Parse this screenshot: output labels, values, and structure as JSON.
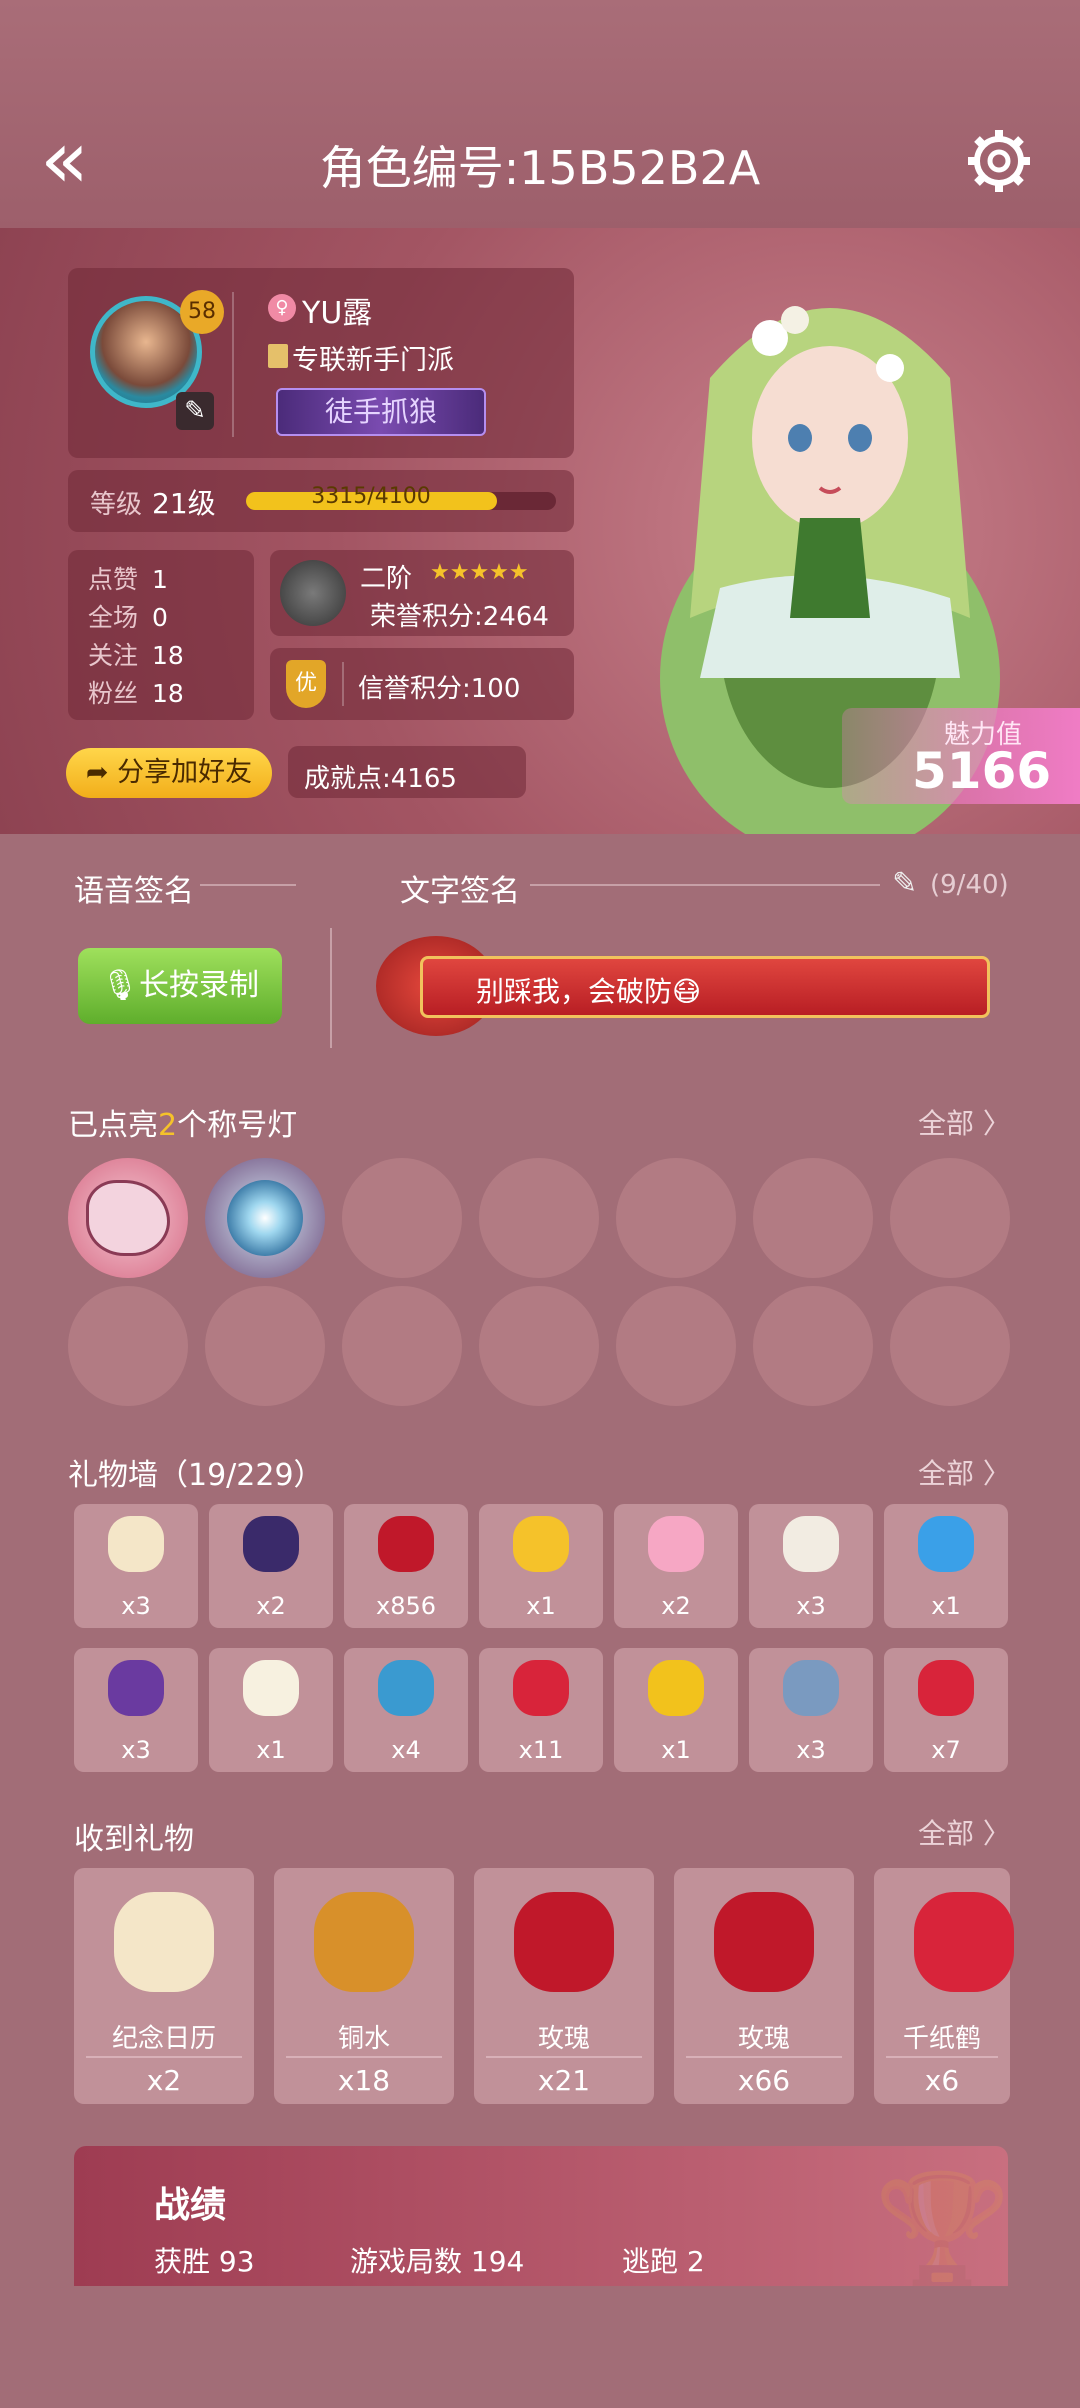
{
  "header": {
    "title": "角色编号:15B52B2A"
  },
  "profile": {
    "name": "YU露",
    "level_badge": "58",
    "sect": "专联新手门派",
    "title_tag": "徒手抓狼",
    "level_label": "等级",
    "level_value": "21级",
    "exp_text": "3315/4100",
    "exp_fraction": 0.8085,
    "stats": [
      {
        "label": "点赞",
        "value": "1"
      },
      {
        "label": "全场",
        "value": "0"
      },
      {
        "label": "关注",
        "value": "18"
      },
      {
        "label": "粉丝",
        "value": "18"
      }
    ],
    "rank_name": "二阶",
    "stars": "★★★★★",
    "honor_points": "荣誉积分:2464",
    "credit_badge": "优",
    "credit_points": "信誉积分:100",
    "share_button": "分享加好友",
    "achievement": "成就点:4165",
    "charm_label": "魅力值",
    "charm_value": "5166"
  },
  "signature": {
    "voice_label": "语音签名",
    "text_label": "文字签名",
    "count": "(9/40)",
    "record_button": "长按录制",
    "text": "别踩我，会破防😷"
  },
  "titles": {
    "prefix": "已点亮",
    "count": "2",
    "suffix": "个称号灯",
    "all": "全部 〉"
  },
  "gift_wall": {
    "title": "礼物墙（19/229）",
    "all": "全部 〉",
    "items": [
      {
        "icon": "calendar",
        "count": "x3"
      },
      {
        "icon": "eye",
        "count": "x2"
      },
      {
        "icon": "rose",
        "count": "x856"
      },
      {
        "icon": "stars",
        "count": "x1"
      },
      {
        "icon": "cotton-candy",
        "count": "x2"
      },
      {
        "icon": "ticket",
        "count": "x3"
      },
      {
        "icon": "magic-book",
        "count": "x1"
      },
      {
        "icon": "purple-star",
        "count": "x3"
      },
      {
        "icon": "dumplings",
        "count": "x1"
      },
      {
        "icon": "life-ring",
        "count": "x4"
      },
      {
        "icon": "paper-crane",
        "count": "x11"
      },
      {
        "icon": "gold-fish",
        "count": "x1"
      },
      {
        "icon": "blue-fish",
        "count": "x3"
      },
      {
        "icon": "lips",
        "count": "x7"
      }
    ]
  },
  "received": {
    "title": "收到礼物",
    "all": "全部 〉",
    "items": [
      {
        "name": "纪念日历",
        "count": "x2"
      },
      {
        "name": "铜水",
        "count": "x18"
      },
      {
        "name": "玫瑰",
        "count": "x21"
      },
      {
        "name": "玫瑰",
        "count": "x66"
      },
      {
        "name": "千纸鹤",
        "count": "x6"
      }
    ]
  },
  "record": {
    "title": "战绩",
    "wins": "获胜 93",
    "games": "游戏局数 194",
    "escapes": "逃跑 2"
  }
}
